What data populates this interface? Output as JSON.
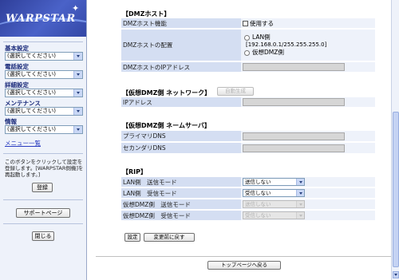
{
  "logo": {
    "text": "WARPSTAR"
  },
  "sidebar": {
    "groups": [
      {
        "label": "基本設定",
        "select": "(選択してください)"
      },
      {
        "label": "電話設定",
        "select": "(選択してください)"
      },
      {
        "label": "詳細設定",
        "select": "(選択してください)"
      },
      {
        "label": "メンテナンス",
        "select": "(選択してください)"
      },
      {
        "label": "情報",
        "select": "(選択してください)"
      }
    ],
    "menu_list": "メニュー一覧",
    "notice": "このボタンをクリックして設定を登録します。[WARPSTAR側機]を再起動します。]",
    "register_button": "登録",
    "support_button": "サポートページ",
    "close_button": "閉じる"
  },
  "dmz_host": {
    "title": "【DMZホスト】",
    "rows": {
      "function": {
        "label": "DMZホスト機能",
        "checkbox_label": "使用する"
      },
      "placement": {
        "label": "DMZホストの配置",
        "option_lan": "LAN側",
        "lan_detail": "[192.168.0.1/255.255.255.0]",
        "option_virtual": "仮想DMZ側"
      },
      "ip": {
        "label": "DMZホストのIPアドレス"
      }
    }
  },
  "virtual_network": {
    "title": "【仮想DMZ側 ネットワーク】",
    "auto_button": "自動生成",
    "ip_label": "IPアドレス"
  },
  "virtual_dns": {
    "title": "【仮想DMZ側 ネームサーバ】",
    "primary_label": "プライマリDNS",
    "secondary_label": "セカンダリDNS"
  },
  "rip": {
    "title": "【RIP】",
    "rows": [
      {
        "label": "LAN側　送信モード",
        "value": "送信しない",
        "disabled": false
      },
      {
        "label": "LAN側　受信モード",
        "value": "受信しない",
        "disabled": false
      },
      {
        "label": "仮想DMZ側　送信モード",
        "value": "送信しない",
        "disabled": true
      },
      {
        "label": "仮想DMZ側　受信モード",
        "value": "受信しない",
        "disabled": true
      }
    ]
  },
  "actions": {
    "set_button": "設定",
    "revert_button": "変更前に戻す"
  },
  "footer": {
    "top_button": "トップページへ戻る"
  }
}
